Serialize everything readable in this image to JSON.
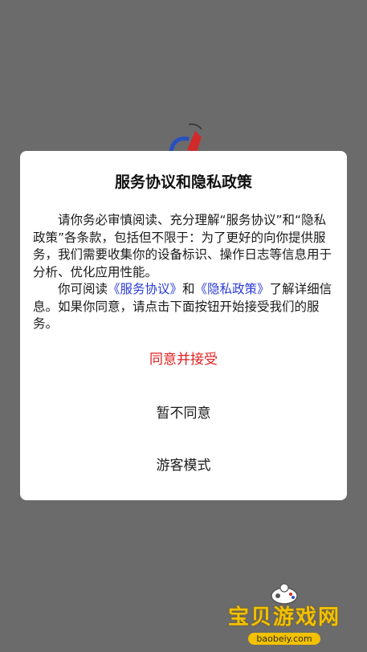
{
  "dialog": {
    "title": "服务协议和隐私政策",
    "para1": "请你务必审慎阅读、充分理解“服务协议”和“隐私政策”各条款，包括但不限于：为了更好的向你提供服务，我们需要收集你的设备标识、操作日志等信息用于分析、优化应用性能。",
    "para2_prefix": "你可阅读",
    "link_service": "《服务协议》",
    "para2_and": "和",
    "link_privacy": "《隐私政策》",
    "para2_suffix": "了解详细信息。如果你同意，请点击下面按钮开始接受我们的服务。",
    "accept_label": "同意并接受",
    "decline_label": "暂不同意",
    "guest_label": "游客模式"
  },
  "watermark": {
    "text": "宝贝游戏网",
    "url": "baobeiy.com"
  },
  "colors": {
    "overlay": "#6b6b6b",
    "accept": "#e02020",
    "link": "#2a3bd6",
    "watermark": "#f2c100"
  }
}
